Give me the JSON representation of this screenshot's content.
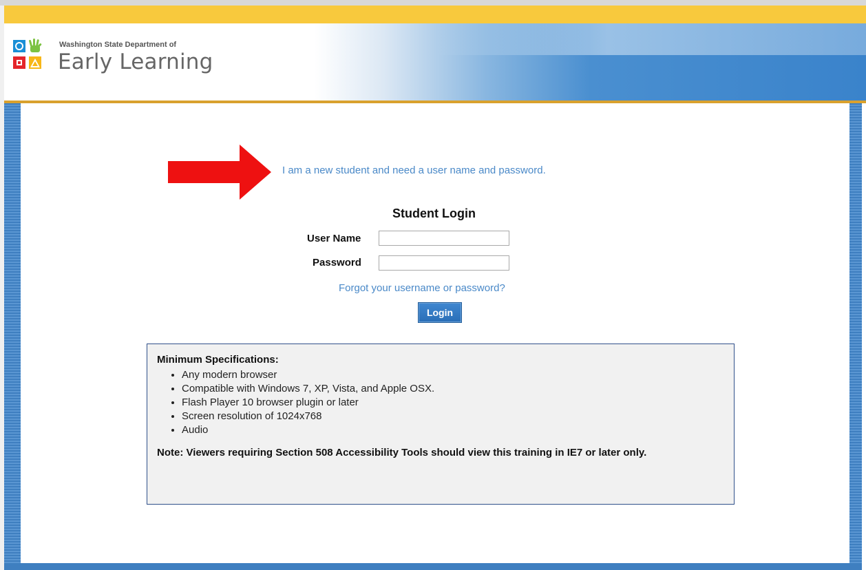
{
  "header": {
    "org_prefix": "Washington State Department of",
    "org_name": "Early Learning"
  },
  "login": {
    "new_student_link": "I am a new student and need a user name and password.",
    "heading": "Student Login",
    "username_label": "User Name",
    "password_label": "Password",
    "username_value": "",
    "password_value": "",
    "forgot_link": "Forgot your username or password?",
    "login_button": "Login"
  },
  "specs": {
    "title": "Minimum Specifications:",
    "items": [
      "Any modern browser",
      "Compatible with Windows 7, XP, Vista, and Apple OSX.",
      "Flash Player 10 browser plugin or later",
      "Screen resolution of 1024x768",
      "Audio"
    ],
    "note": "Note: Viewers requiring Section 508 Accessibility Tools should view this training in IE7 or later only."
  },
  "colors": {
    "link": "#4a89c8",
    "header_yellow": "#f8c93d",
    "frame_blue": "#3f7fc0",
    "button_blue": "#2a6fb8",
    "arrow_red": "#ee1111"
  },
  "icons": {
    "logo": "del-logo-icon",
    "arrow": "red-arrow-icon"
  }
}
